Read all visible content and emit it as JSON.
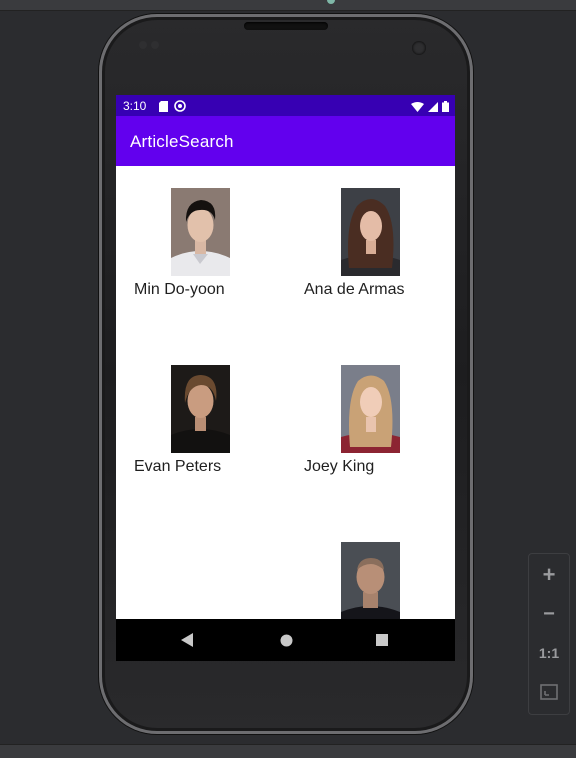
{
  "status_bar": {
    "time": "3:10"
  },
  "app_bar": {
    "title": "ArticleSearch"
  },
  "people": [
    {
      "name": "Min Do-yoon"
    },
    {
      "name": "Ana de Armas"
    },
    {
      "name": "Evan Peters"
    },
    {
      "name": "Joey King"
    },
    {
      "name": ""
    },
    {
      "name": ""
    }
  ],
  "zoom_controls": {
    "plus_label": "+",
    "minus_label": "−",
    "actual_size_label": "1:1"
  },
  "colors": {
    "status_bar": "#3700b3",
    "app_bar": "#6200ee",
    "nav_bar": "#000000"
  }
}
